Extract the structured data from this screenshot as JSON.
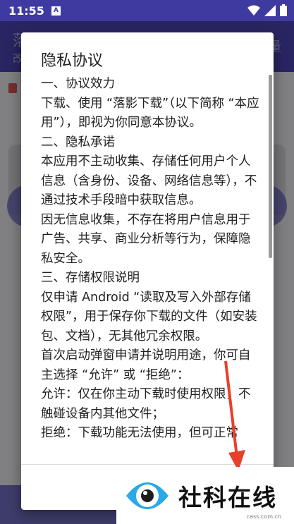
{
  "status_bar": {
    "time": "11:55",
    "notification": "A"
  },
  "app": {
    "title": "落影下载",
    "subtitle": "改",
    "right_action": "量"
  },
  "dialog": {
    "title": "隐私协议",
    "paragraphs": [
      "一、协议效力",
      "下载、使用 “落影下载”（以下简称 “本应用”），即视为你同意本协议。",
      "二、隐私承诺",
      "本应用不主动收集、存储任何用户个人信息（含身份、设备、网络信息等），不通过技术手段暗中获取信息。",
      "因无信息收集，不存在将用户信息用于广告、共享、商业分析等行为，保障隐私安全。",
      "三、存储权限说明",
      "仅申请 Android “读取及写入外部存储权限”，用于保存你下载的文件（如安装包、文档），无其他冗余权限。",
      "首次启动弹窗申请并说明用途，你可自主选择 “允许” 或 “拒绝”：",
      "允许：仅在你主动下载时使用权限，不触碰设备内其他文件；",
      "拒绝：下载功能无法使用，但可正常"
    ]
  },
  "watermark": {
    "brand": "社科在线",
    "url": "cass.com.cn"
  },
  "colors": {
    "primary": "#4a44b3",
    "accent_arrow": "#e8402c"
  }
}
